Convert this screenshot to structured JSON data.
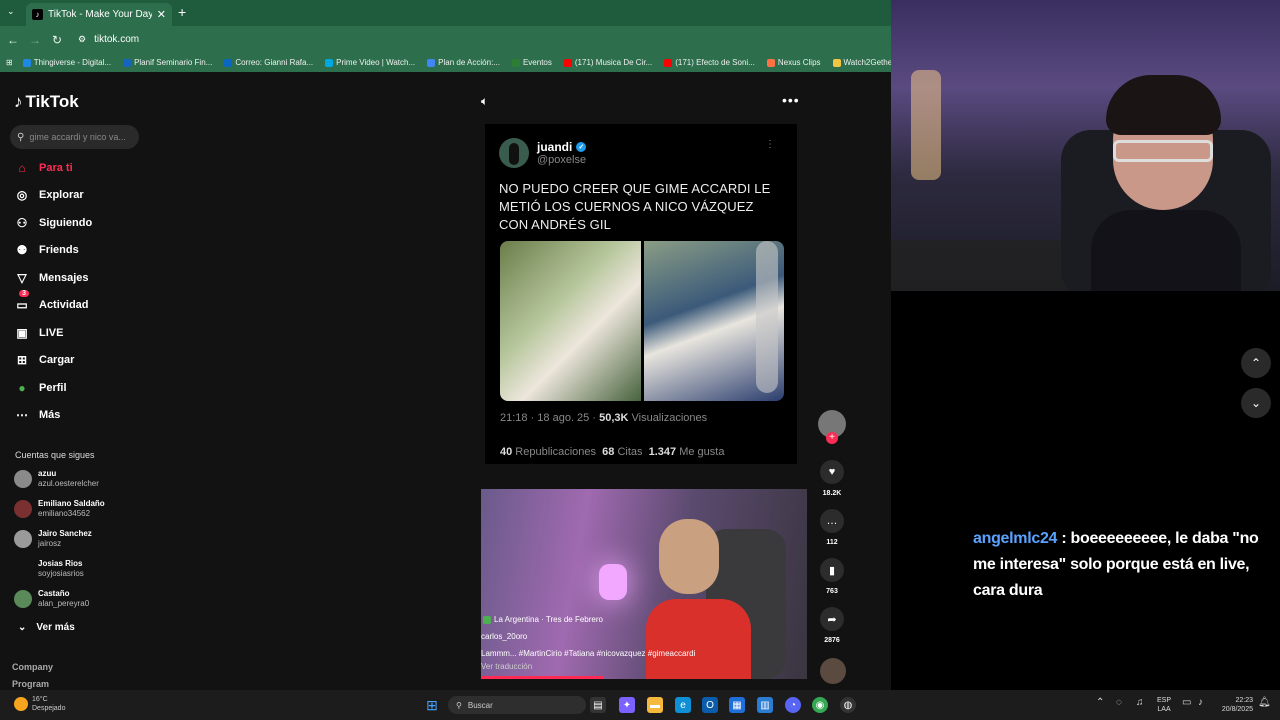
{
  "browser": {
    "tab_title": "TikTok - Make Your Day",
    "tab_close": "✕",
    "new_tab": "+",
    "url": "tiktok.com",
    "bookmarks": [
      {
        "label": "Thingiverse - Digital...",
        "color": "#1e88e5"
      },
      {
        "label": "Planif Seminario Fin...",
        "color": "#1565c0"
      },
      {
        "label": "Correo: Gianni Rafa...",
        "color": "#0a66c2"
      },
      {
        "label": "Prime Video | Watch...",
        "color": "#00a8e1"
      },
      {
        "label": "Plan de Acción:...",
        "color": "#4285f4"
      },
      {
        "label": "Eventos",
        "color": "#2e7d32"
      },
      {
        "label": "(171) Musica De Cir...",
        "color": "#ff0000"
      },
      {
        "label": "(171) Efecto de Soni...",
        "color": "#ff0000"
      },
      {
        "label": "Nexus Clips",
        "color": "#ff7043"
      },
      {
        "label": "Watch2Gether",
        "color": "#f4c542"
      }
    ]
  },
  "sidebar": {
    "logo": "TikTok",
    "search_placeholder": "gime accardi y nico va...",
    "nav": [
      {
        "label": "Para ti",
        "icon": "home-icon",
        "glyph": "⌂"
      },
      {
        "label": "Explorar",
        "icon": "compass-icon",
        "glyph": "◎"
      },
      {
        "label": "Siguiendo",
        "icon": "following-icon",
        "glyph": "⚇"
      },
      {
        "label": "Friends",
        "icon": "friends-icon",
        "glyph": "⚉"
      },
      {
        "label": "Mensajes",
        "icon": "messages-icon",
        "glyph": "▽"
      },
      {
        "label": "Actividad",
        "icon": "activity-icon",
        "glyph": "▭",
        "badge": "3"
      },
      {
        "label": "LIVE",
        "icon": "live-icon",
        "glyph": "▣"
      },
      {
        "label": "Cargar",
        "icon": "upload-icon",
        "glyph": "⊞"
      },
      {
        "label": "Perfil",
        "icon": "profile-icon",
        "glyph": "●"
      },
      {
        "label": "Más",
        "icon": "more-icon",
        "glyph": "⋯"
      }
    ],
    "following_title": "Cuentas que sigues",
    "accounts": [
      {
        "name": "azuu",
        "user": "azul.oesterelcher"
      },
      {
        "name": "Emiliano Saldaño",
        "user": "emiliano34562"
      },
      {
        "name": "Jairo Sanchez",
        "user": "jairosz"
      },
      {
        "name": "Josias Rios",
        "user": "soyjosiasrios"
      },
      {
        "name": "Castaño",
        "user": "alan_pereyra0"
      }
    ],
    "see_more": "Ver más",
    "footer": [
      "Company",
      "Program"
    ]
  },
  "post": {
    "tweet": {
      "name": "juandi",
      "handle": "@poxelse",
      "text": "NO PUEDO CREER QUE GIME ACCARDI LE METIÓ LOS CUERNOS A NICO VÁZQUEZ CON ANDRÉS GIL",
      "time": "21:18 · 18 ago. 25 · ",
      "views_count": "50,3K",
      "views_label": " Visualizaciones",
      "reposts_count": "40",
      "reposts_label": " Republicaciones  ",
      "quotes_count": "68",
      "quotes_label": " Citas  ",
      "likes_count": "1.347",
      "likes_label": " Me gusta"
    },
    "video": {
      "location": "La Argentina · Tres de Febrero",
      "user": "carlos_20oro",
      "caption": "Lammm... #MartinCirio #Tatiana #nicovazquez #gimeaccardi",
      "translate": "Ver traducción"
    },
    "actions": {
      "likes": "18.2K",
      "comments": "112",
      "saves": "763",
      "shares": "2876"
    }
  },
  "chat": {
    "user": "angelmlc24",
    "sep": " : ",
    "message": "boeeeeeeeee, le daba \"no me interesa\" solo porque está en live, cara dura"
  },
  "taskbar": {
    "temp": "16°C",
    "weather": "Despejado",
    "search": "Buscar",
    "lang": "ESP",
    "lang2": "LAA",
    "time": "22:23",
    "date": "20/8/2025"
  }
}
